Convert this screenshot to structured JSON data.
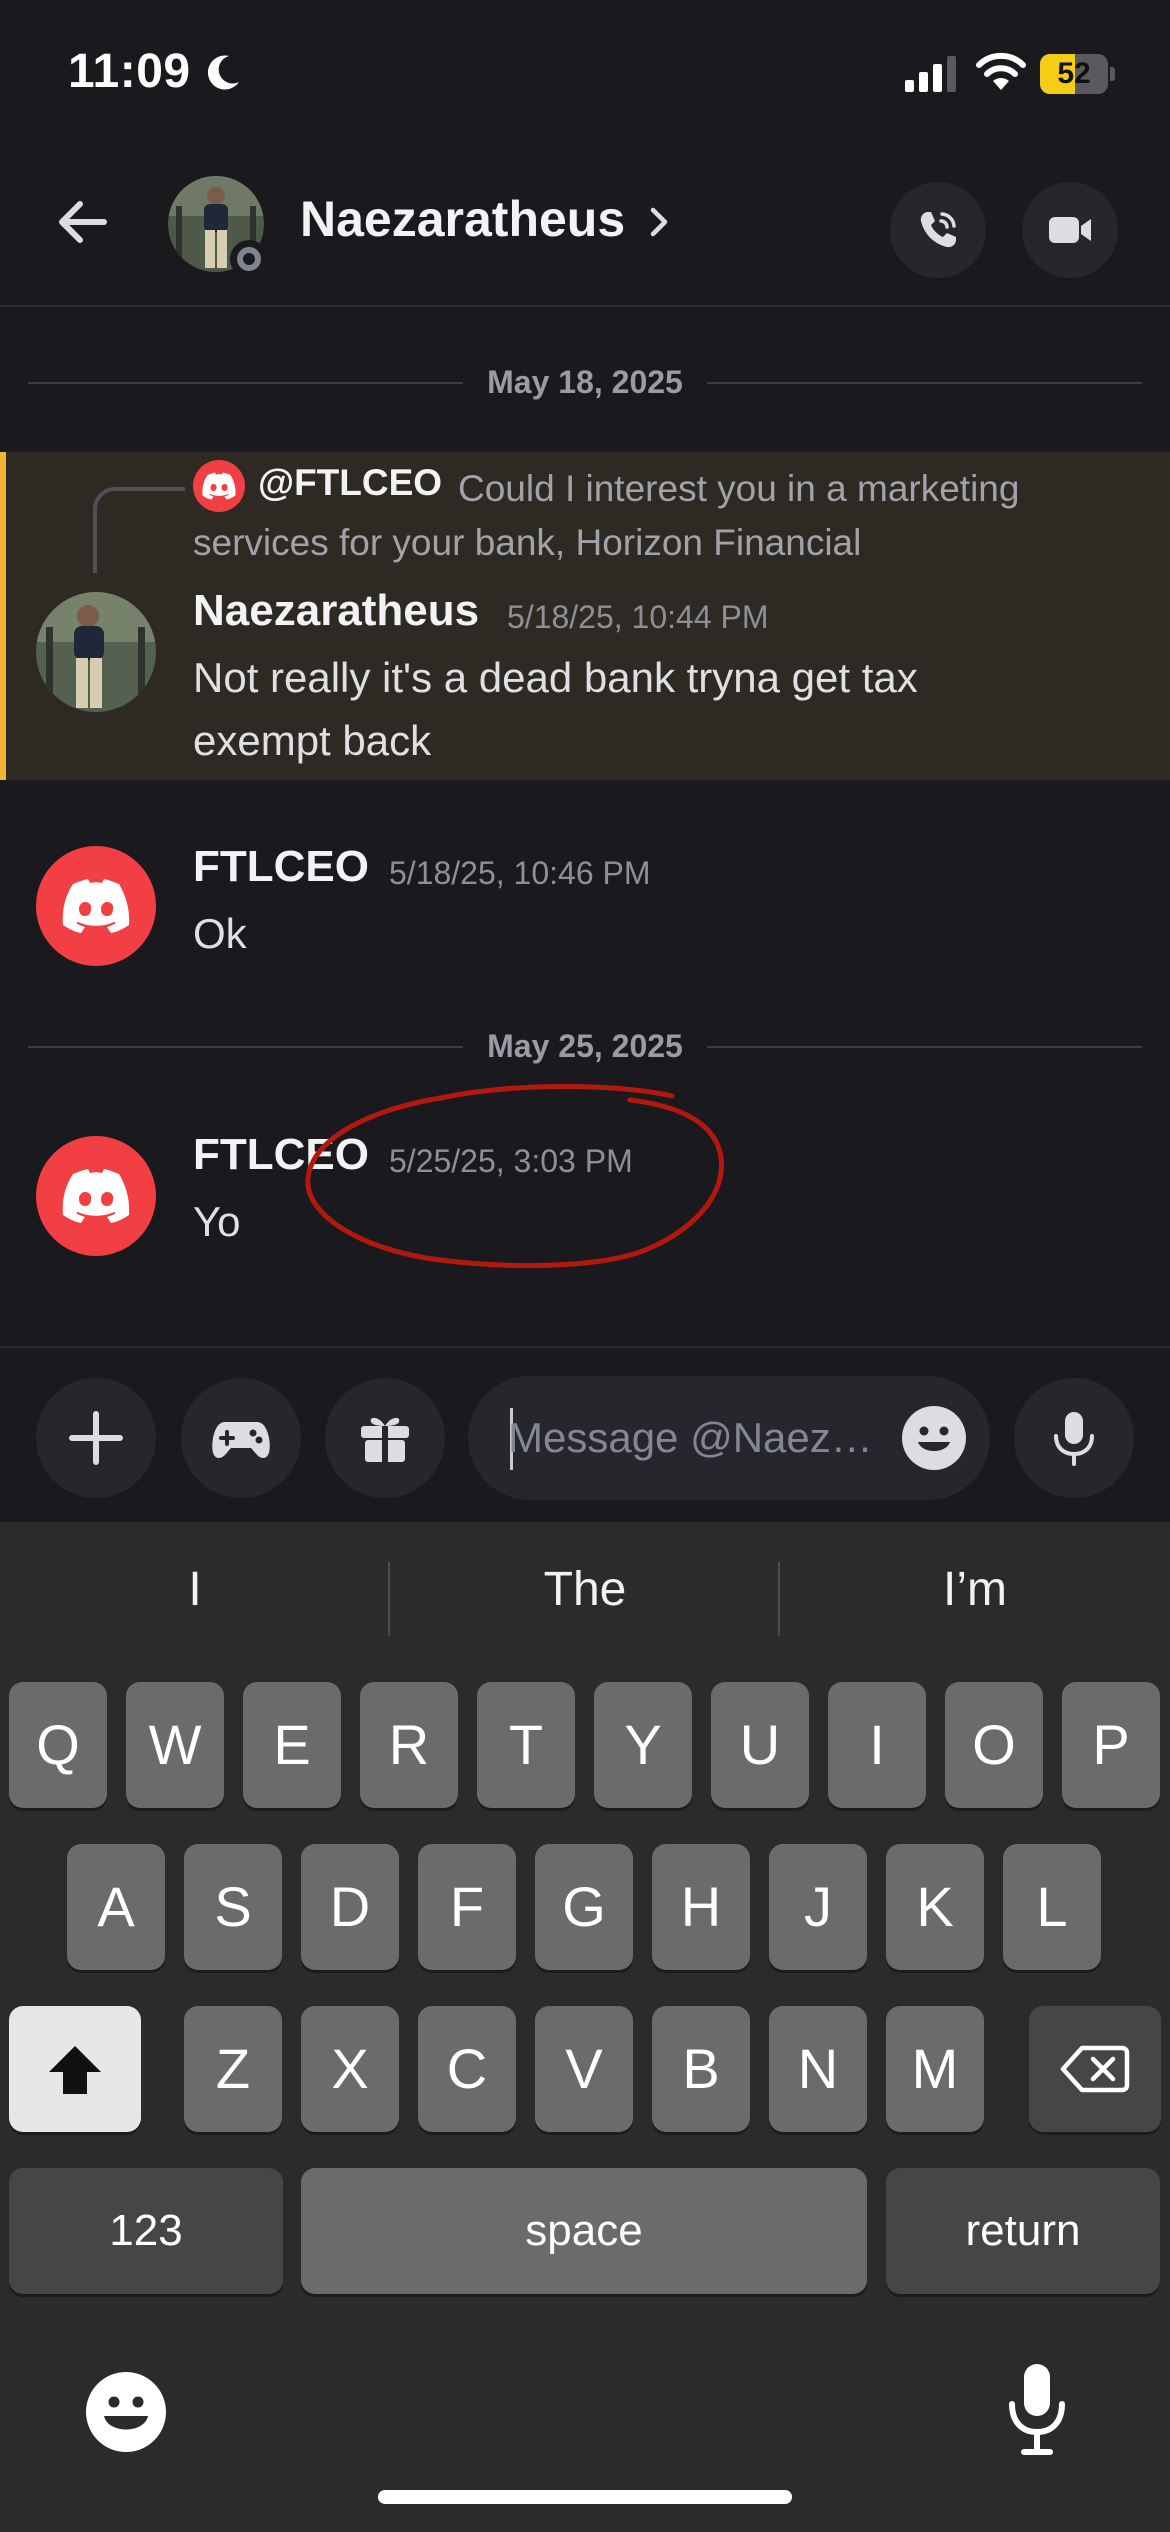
{
  "status_bar": {
    "time": "11:09",
    "battery": "52",
    "battery_percent": 52,
    "focus_icon": "moon-icon"
  },
  "header": {
    "title": "Naezaratheus",
    "chevron": "›",
    "icons": [
      "back-arrow-icon",
      "phone-call-icon",
      "video-camera-icon"
    ]
  },
  "dividers": [
    {
      "label": "May 18, 2025"
    },
    {
      "label": "May 25, 2025"
    }
  ],
  "messages": [
    {
      "reply": {
        "author": "@FTLCEO",
        "text": "Could I interest you in a marketing services for your bank, Horizon Financial"
      },
      "author": "Naezaratheus",
      "timestamp": "5/18/25, 10:44 PM",
      "text_line1": "Not really it's a dead bank tryna get tax",
      "text_line2": "exempt back",
      "highlighted": true
    },
    {
      "author": "FTLCEO",
      "timestamp": "5/18/25, 10:46 PM",
      "text": "Ok"
    },
    {
      "author": "FTLCEO",
      "timestamp": "5/25/25, 3:03 PM",
      "text": "Yo"
    }
  ],
  "input_bar": {
    "placeholder": "Message @Naez…",
    "buttons": [
      "plus-icon",
      "gamepad-icon",
      "gift-icon",
      "emoji-icon",
      "microphone-icon"
    ]
  },
  "keyboard": {
    "suggestions": [
      "I",
      "The",
      "I’m"
    ],
    "row1": [
      "Q",
      "W",
      "E",
      "R",
      "T",
      "Y",
      "U",
      "I",
      "O",
      "P"
    ],
    "row2": [
      "A",
      "S",
      "D",
      "F",
      "G",
      "H",
      "J",
      "K",
      "L"
    ],
    "row3": [
      "Z",
      "X",
      "C",
      "V",
      "B",
      "N",
      "M"
    ],
    "numbers_label": "123",
    "space_label": "space",
    "return_label": "return"
  },
  "colors": {
    "background": "#1a1a1e",
    "discord_red": "#f23f43",
    "highlight_bar": "#f0b232",
    "annotation": "#b3180e",
    "battery": "#f5cc16"
  }
}
